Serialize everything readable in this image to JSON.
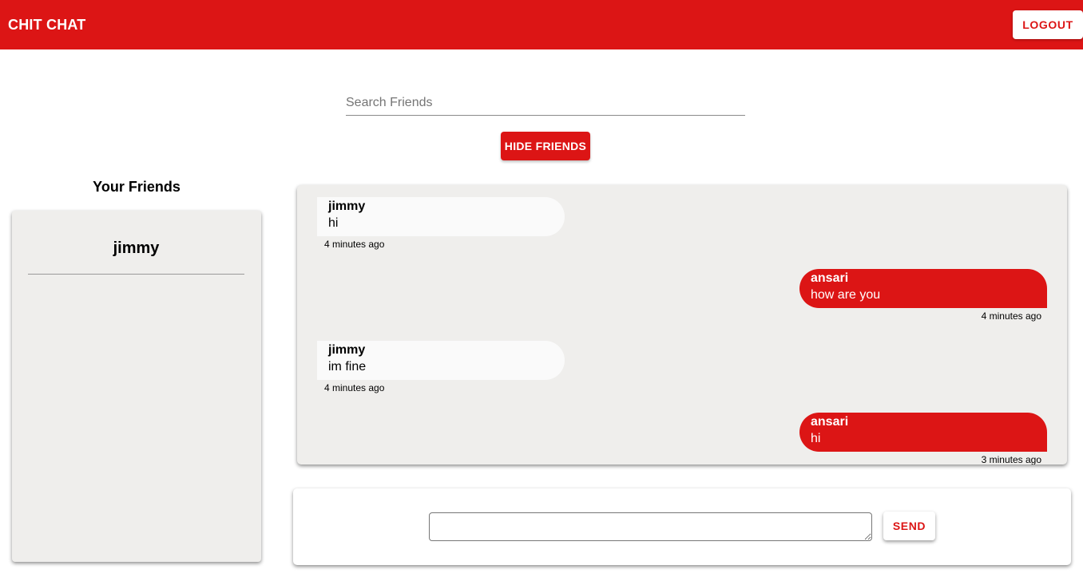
{
  "header": {
    "brand": "CHIT CHAT",
    "logout_label": "LOGOUT"
  },
  "search": {
    "placeholder": "Search Friends",
    "value": ""
  },
  "toggle_label": "HIDE FRIENDS",
  "friends": {
    "title": "Your Friends",
    "items": [
      {
        "name": "jimmy"
      }
    ]
  },
  "messages": [
    {
      "sender": "jimmy",
      "text": "hi",
      "time": "4 minutes ago",
      "direction": "incoming"
    },
    {
      "sender": "ansari",
      "text": "how are you",
      "time": "4 minutes ago",
      "direction": "outgoing"
    },
    {
      "sender": "jimmy",
      "text": "im fine",
      "time": "4 minutes ago",
      "direction": "incoming"
    },
    {
      "sender": "ansari",
      "text": "hi",
      "time": "3 minutes ago",
      "direction": "outgoing"
    }
  ],
  "compose": {
    "value": "",
    "send_label": "SEND"
  },
  "colors": {
    "accent": "#dc1515",
    "panel": "#efeeec",
    "incoming_bubble": "#fafafa"
  }
}
